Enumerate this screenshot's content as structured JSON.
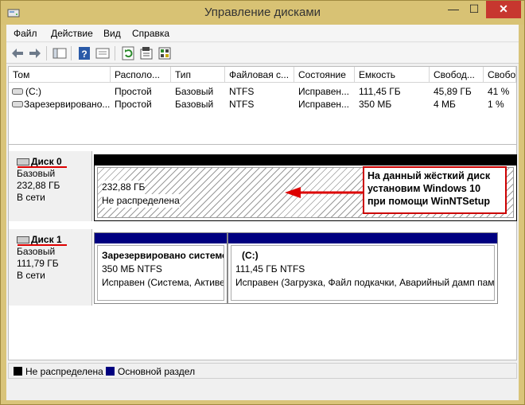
{
  "window": {
    "title": "Управление дисками",
    "controls": {
      "minimize": "—",
      "maximize": "☐",
      "close": "✕"
    }
  },
  "menu": [
    "Файл",
    "Действие",
    "Вид",
    "Справка"
  ],
  "toolbar": {
    "icons": [
      "back-icon",
      "forward-icon",
      "console-tree-icon",
      "help-icon",
      "properties-list-icon",
      "refresh-icon",
      "properties-icon",
      "show-hide-icon"
    ]
  },
  "volume_list": {
    "columns": [
      "Том",
      "Располо...",
      "Тип",
      "Файловая с...",
      "Состояние",
      "Емкость",
      "Свобод...",
      "Свобо..."
    ],
    "rows": [
      [
        "(C:)",
        "Простой",
        "Базовый",
        "NTFS",
        "Исправен...",
        "111,45 ГБ",
        "45,89 ГБ",
        "41 %"
      ],
      [
        "Зарезервировано...",
        "Простой",
        "Базовый",
        "NTFS",
        "Исправен...",
        "350 МБ",
        "4 МБ",
        "1 %"
      ]
    ],
    "scroll_left": "<",
    "scroll_right": ">"
  },
  "disks": [
    {
      "name": "Диск 0",
      "type": "Базовый",
      "size": "232,88 ГБ",
      "status": "В сети",
      "partitions": [
        {
          "size": "232,88 ГБ",
          "status": "Не распределена",
          "kind": "unallocated"
        }
      ]
    },
    {
      "name": "Диск 1",
      "type": "Базовый",
      "size": "111,79 ГБ",
      "status": "В сети",
      "partitions": [
        {
          "title": "Зарезервировано системой",
          "size": "350 МБ NTFS",
          "status": "Исправен (Система, Активен, Основной раздел)",
          "kind": "primary"
        },
        {
          "title": "(C:)",
          "size": "111,45 ГБ NTFS",
          "status": "Исправен (Загрузка, Файл подкачки, Аварийный дамп памяти, Основной раздел)",
          "kind": "primary"
        }
      ]
    }
  ],
  "annotation": {
    "lines": [
      "На данный жёсткий диск",
      "установим Windows 10",
      "при помощи WinNTSetup"
    ],
    "color": "#dd0000"
  },
  "legend": [
    {
      "label": "Не распределена",
      "color": "#000000"
    },
    {
      "label": "Основной раздел",
      "color": "#00007f"
    }
  ],
  "colors": {
    "primary_partition": "#000080",
    "unallocated_header": "#000000",
    "title_bar": "#d8c274",
    "close_button": "#c7372f"
  }
}
